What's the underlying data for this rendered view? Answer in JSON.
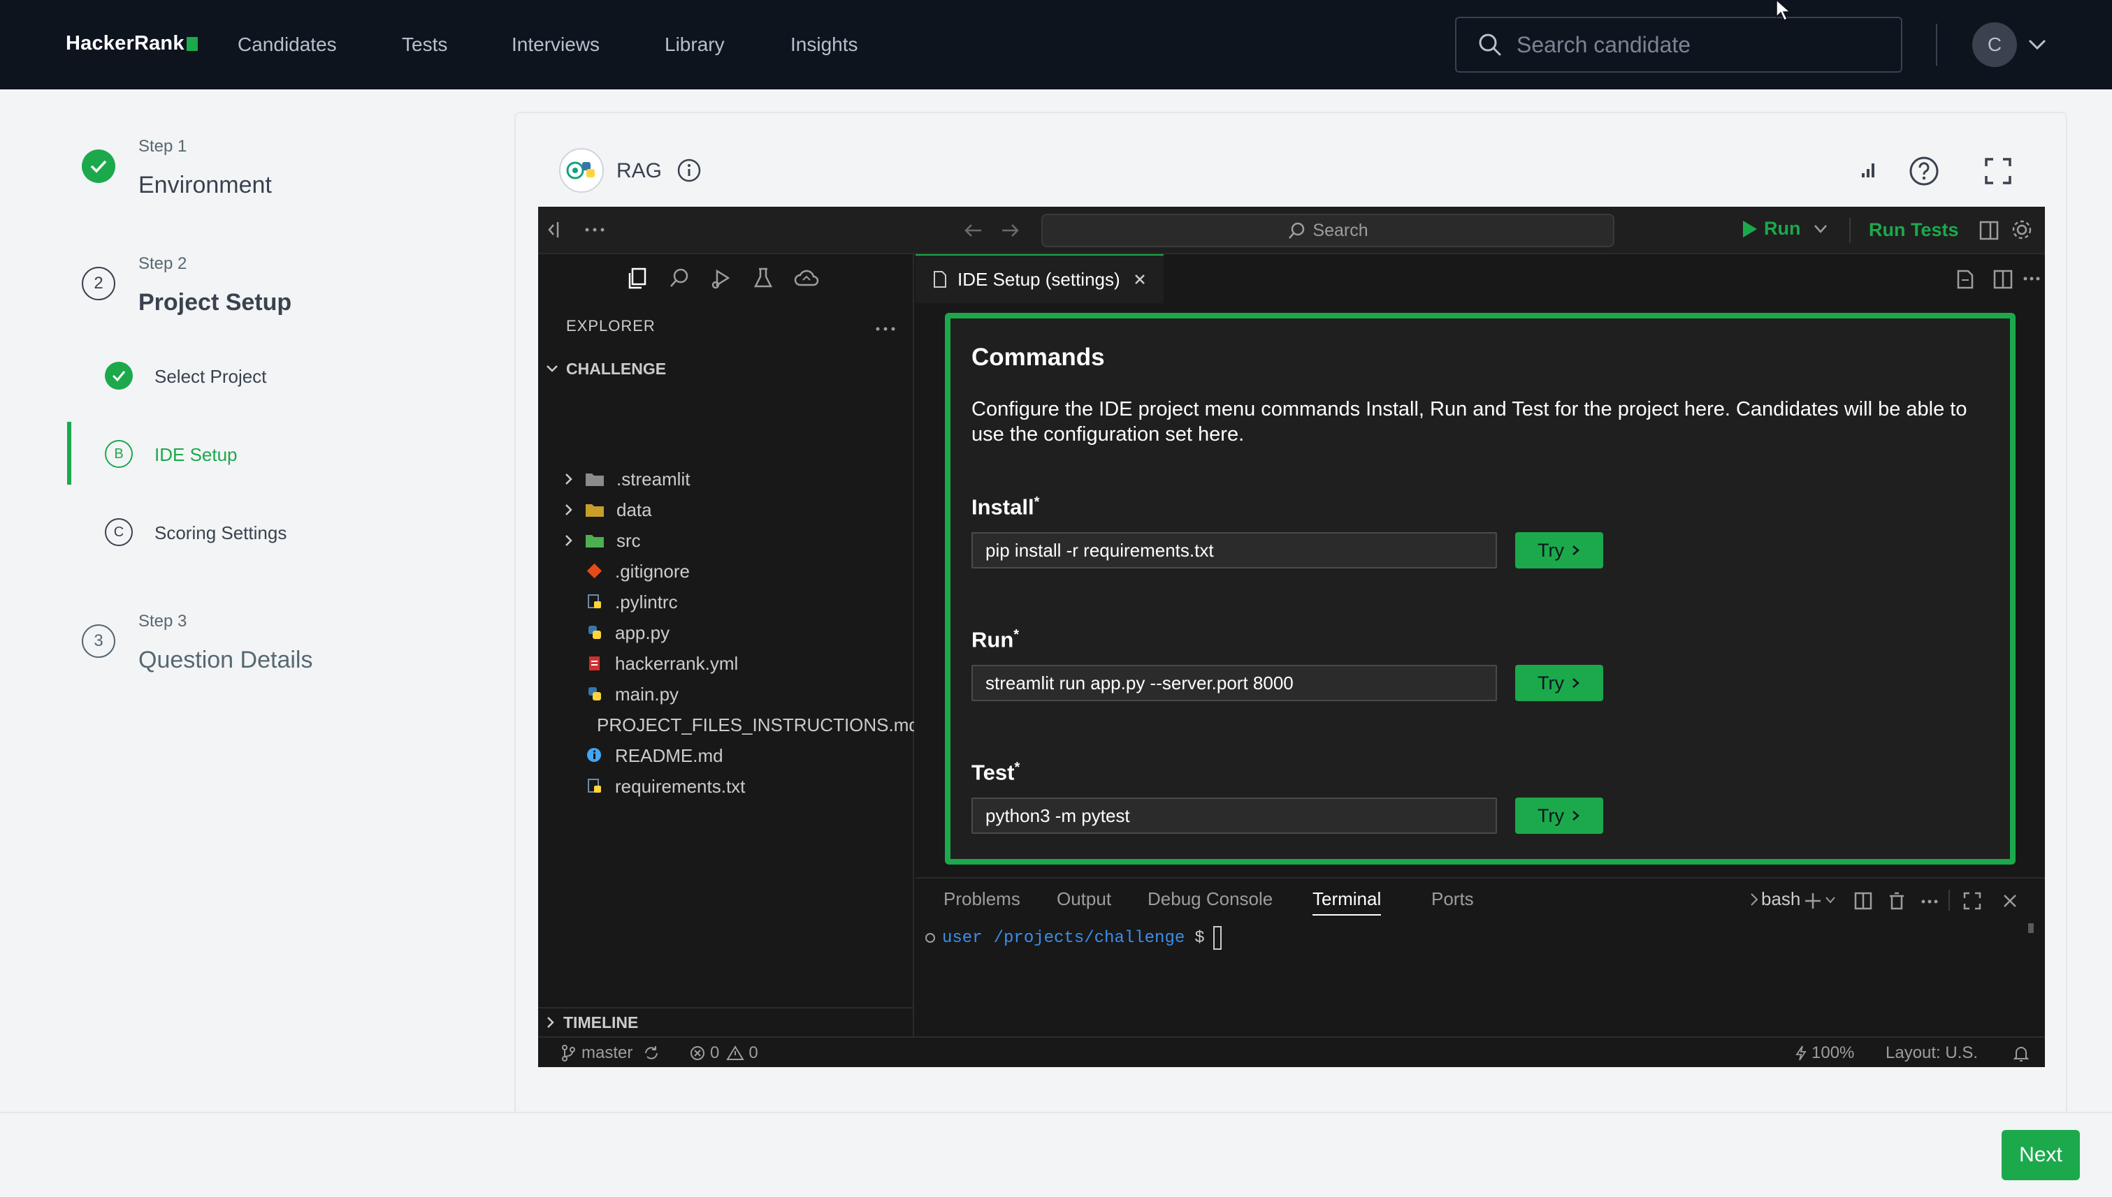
{
  "nav": {
    "logo": "HackerRank",
    "items": [
      "Candidates",
      "Tests",
      "Interviews",
      "Library",
      "Insights"
    ],
    "search_placeholder": "Search candidate",
    "avatar_initial": "C"
  },
  "stepper": {
    "step1": {
      "label": "Step 1",
      "title": "Environment"
    },
    "step2": {
      "number": "2",
      "label": "Step 2",
      "title": "Project Setup"
    },
    "substeps": [
      {
        "marker": "",
        "label": "Select Project"
      },
      {
        "marker": "B",
        "label": "IDE Setup"
      },
      {
        "marker": "C",
        "label": "Scoring Settings"
      }
    ],
    "step3": {
      "number": "3",
      "label": "Step 3",
      "title": "Question Details"
    }
  },
  "card": {
    "title": "RAG"
  },
  "ide": {
    "search": "Search",
    "run": "Run",
    "run_tests": "Run Tests",
    "explorer": "EXPLORER",
    "root": "CHALLENGE",
    "files": [
      {
        "name": ".streamlit",
        "kind": "folder",
        "color": "#8b8b8b"
      },
      {
        "name": "data",
        "kind": "folder",
        "color": "#c69e2a"
      },
      {
        "name": "src",
        "kind": "folder",
        "color": "#4caf50"
      },
      {
        "name": ".gitignore",
        "kind": "git",
        "color": "#e64a19"
      },
      {
        "name": ".pylintrc",
        "kind": "config",
        "color": "#6d8aa8"
      },
      {
        "name": "app.py",
        "kind": "python",
        "color": "#3776ab"
      },
      {
        "name": "hackerrank.yml",
        "kind": "yaml",
        "color": "#d32f2f"
      },
      {
        "name": "main.py",
        "kind": "python",
        "color": "#3776ab"
      },
      {
        "name": "PROJECT_FILES_INSTRUCTIONS.md",
        "kind": "markdown",
        "color": "#42a5f5"
      },
      {
        "name": "README.md",
        "kind": "info",
        "color": "#42a5f5"
      },
      {
        "name": "requirements.txt",
        "kind": "config",
        "color": "#6d8aa8"
      }
    ],
    "timeline": "TIMELINE",
    "tab": "IDE Setup (settings)",
    "commands": {
      "title": "Commands",
      "description": "Configure the IDE project menu commands Install, Run and Test for the project here. Candidates will be able to use the configuration set here.",
      "install_label": "Install",
      "install_value": "pip install -r requirements.txt",
      "run_label": "Run",
      "run_value": "streamlit run app.py --server.port 8000",
      "test_label": "Test",
      "test_value": "python3 -m pytest",
      "required_mark": "*",
      "try_label": "Try"
    },
    "panel_tabs": [
      "Problems",
      "Output",
      "Debug Console",
      "Terminal",
      "Ports"
    ],
    "shell": "bash",
    "terminal": {
      "user": "user",
      "path": "/projects/challenge",
      "prompt": "$"
    },
    "status": {
      "branch": "master",
      "errors": "0",
      "warnings": "0",
      "zoom": "100%",
      "layout": "Layout: U.S."
    }
  },
  "footer": {
    "next": "Next"
  },
  "colors": {
    "accent": "#1ba94c",
    "nav_bg": "#0e141e",
    "ide_bg": "#181818"
  }
}
